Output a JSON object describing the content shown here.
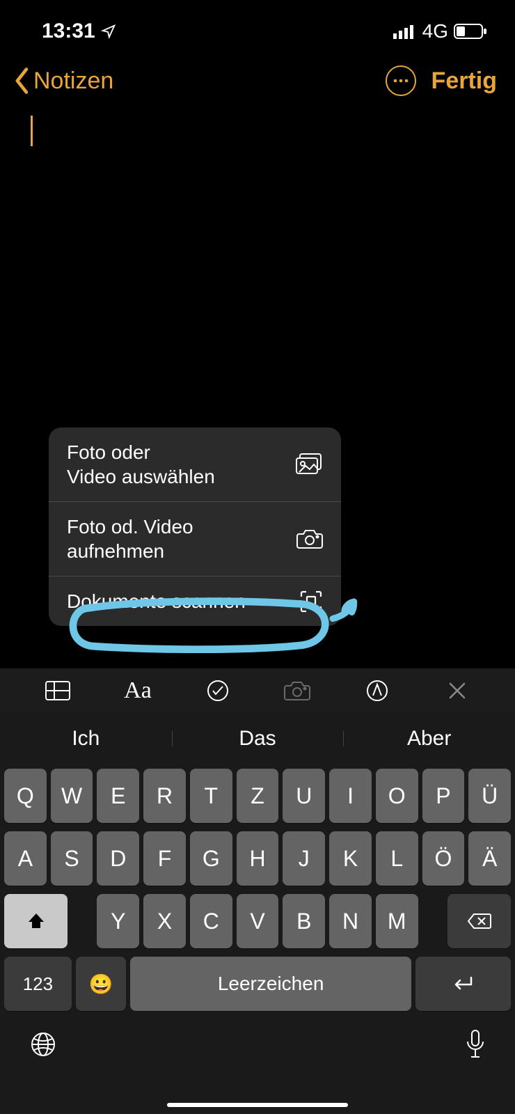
{
  "status": {
    "time": "13:31",
    "network": "4G"
  },
  "nav": {
    "back_label": "Notizen",
    "done_label": "Fertig"
  },
  "popover": {
    "items": [
      {
        "label": "Foto oder\nVideo auswählen",
        "icon": "photo-icon"
      },
      {
        "label": "Foto od. Video\naufnehmen",
        "icon": "camera-icon"
      },
      {
        "label": "Dokumente scannen",
        "icon": "scan-icon"
      }
    ]
  },
  "toolbar": {
    "items": [
      "table-icon",
      "text-format-icon",
      "checkmark-icon",
      "camera-icon",
      "markup-icon",
      "close-icon"
    ]
  },
  "keyboard": {
    "suggestions": [
      "Ich",
      "Das",
      "Aber"
    ],
    "row1": [
      "Q",
      "W",
      "E",
      "R",
      "T",
      "Z",
      "U",
      "I",
      "O",
      "P",
      "Ü"
    ],
    "row2": [
      "A",
      "S",
      "D",
      "F",
      "G",
      "H",
      "J",
      "K",
      "L",
      "Ö",
      "Ä"
    ],
    "row3": [
      "Y",
      "X",
      "C",
      "V",
      "B",
      "N",
      "M"
    ],
    "numkey": "123",
    "space": "Leerzeichen"
  },
  "colors": {
    "accent": "#e9a43a"
  }
}
